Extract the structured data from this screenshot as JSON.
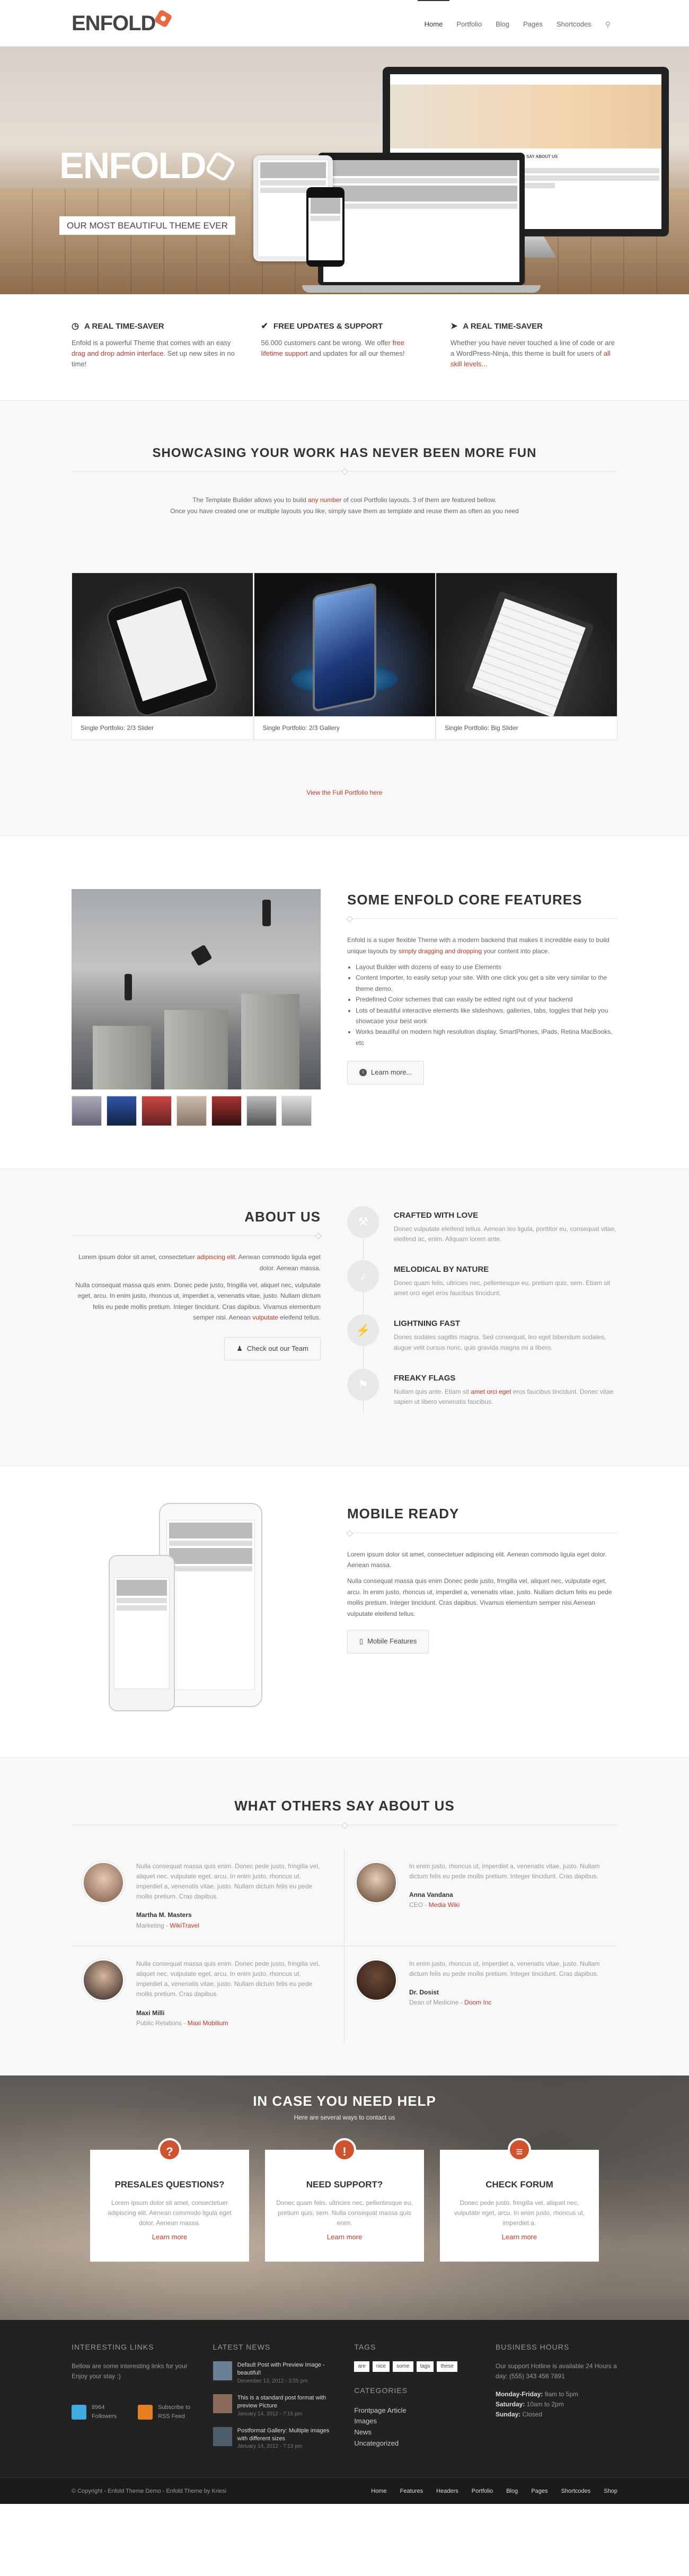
{
  "header": {
    "logo_text": "ENFOLD",
    "nav": [
      "Home",
      "Portfolio",
      "Blog",
      "Pages",
      "Shortcodes"
    ],
    "search_icon": "search-icon"
  },
  "hero": {
    "title": "ENFOLD",
    "tagline": "OUR MOST BEAUTIFUL THEME EVER",
    "screen_heading": "WHAT OTHERS SAY ABOUT US"
  },
  "features3": [
    {
      "icon": "clock-icon",
      "title": "A REAL TIME-SAVER",
      "pre": "Enfold is a powerful Theme that comes with an easy ",
      "link": "drag and drop admin interface.",
      "post": " Set up new sites in no time!"
    },
    {
      "icon": "check-icon",
      "title": "FREE UPDATES & SUPPORT",
      "pre": "56.000 customers cant be wrong. We offer ",
      "link": "free lifetime support",
      "post": " and updates for all our themes!"
    },
    {
      "icon": "rocket-icon",
      "title": "A REAL TIME-SAVER",
      "pre": "Whether you have never touched a line of code or are a WordPress-Ninja, this theme is built for users of ",
      "link": "all skill levels...",
      "post": ""
    }
  ],
  "showcase": {
    "title": "SHOWCASING YOUR WORK HAS NEVER BEEN MORE FUN",
    "intro_pre": "The Template Builder allows you to build ",
    "intro_link": "any number",
    "intro_post": " of cool Portfolio layouts. 3 of them are featured bellow.",
    "intro_line2": "Once you have created one or multiple layouts you like, simply save them as template and reuse them as often as you need",
    "items": [
      "Single Portfolio: 2/3 Slider",
      "Single Portfolio: 2/3 Gallery",
      "Single Portfolio: Big Slider"
    ],
    "view_all": "View the Full Portfolio here"
  },
  "core": {
    "title": "SOME ENFOLD CORE FEATURES",
    "p_pre": "Enfold is a super flexible Theme with a modern backend that makes it incredible easy to build unique layouts by ",
    "p_link": "simply dragging and dropping",
    "p_post": " your content into place.",
    "bullets": [
      "Layout Builder with dozens of easy to use Elements",
      "Content Importer, to easily setup your site. With one click you get a site very similar to the theme demo.",
      "Predefined Color schemes that can easily be edited right out of your backend",
      "Lots of beautiful interactive elements like slideshows, galleries, tabs, toggles that help you showcase your best work",
      "Works beautiful on modern high resolution display, SmartPhones, iPads, Retina MacBooks, etc"
    ],
    "button": "Learn more..."
  },
  "about": {
    "title": "ABOUT US",
    "p1_pre": "Lorem ipsum dolor sit amet, consectetuer ",
    "p1_link": "adipiscing elit",
    "p1_post": ". Aenean commodo ligula eget dolor. Aenean massa.",
    "p2": "Nulla consequat massa quis enim. Donec pede justo, fringilla vel, aliquet nec, vulputate eget, arcu. In enim justo, rhoncus ut, imperdiet a, venenatis vitae, justo. Nullam dictum felis eu pede mollis pretium. Integer tincidunt. Cras dapibus. Vivamus elementum semper nisi. Aenean ",
    "p2_link": "vulputate",
    "p2_post": " eleifend tellus.",
    "button": "Check out our Team",
    "items": [
      {
        "icon": "tools-icon",
        "title": "CRAFTED WITH LOVE",
        "text": "Donec vulputate eleifend tellus. Aenean leo ligula, porttitor eu, consequat vitae, eleifend ac, enim. Aliquam lorem ante."
      },
      {
        "icon": "music-note-icon",
        "title": "MELODICAL BY NATURE",
        "text": "Donec quam felis, ultricies nec, pellentesque eu, pretium quis, sem. Etiam sit amet orci eget eros faucibus tincidunt."
      },
      {
        "icon": "lightning-icon",
        "title": "LIGHTNING FAST",
        "text": "Donec sodales sagittis magna. Sed consequat, leo eget bibendum sodales, augue velit cursus nunc, quis gravida magna mi a libero."
      },
      {
        "icon": "flag-icon",
        "title": "FREAKY FLAGS",
        "text_pre": "Nullam quis ante. Etiam sit ",
        "text_link": "amet orci eget",
        "text_post": " eros faucibus tincidunt. Donec vitae sapien ut libero venenatis faucibus."
      }
    ]
  },
  "mobile": {
    "title": "MOBILE READY",
    "p1": "Lorem ipsum dolor sit amet, consectetuer adipiscing elit. Aenean commodo ligula eget dolor. Aenean massa.",
    "p2": "Nulla consequat massa quis enim Donec pede justo, fringilla vel, aliquet nec, vulputate eget, arcu. In enim justo, rhoncus ut, imperdiet a, venenatis vitae, justo. Nullam dictum felis eu pede mollis pretium. Integer tincidunt. Cras dapibus. Vivamus elementum semper nisi.Aenean vulputate eleifend tellus.",
    "button": "Mobile Features"
  },
  "testimonials": {
    "title": "WHAT OTHERS SAY ABOUT US",
    "items": [
      {
        "text": "Nulla consequat massa quis enim. Donec pede justo, fringilla vel, aliquet nec, vulputate eget, arcu. In enim justo, rhoncus ut, imperdiet a, venenatis vitae, justo. Nullam dictum felis eu pede mollis pretium. Cras dapibus.",
        "name": "Martha M. Masters",
        "role": "Marketing - ",
        "company": "WikiTravel"
      },
      {
        "text": "In enim justo, rhoncus ut, imperdiet a, venenatis vitae, justo. Nullam dictum felis eu pede mollis pretium. Integer tincidunt. Cras dapibus.",
        "name": "Anna Vandana",
        "role": "CEO - ",
        "company": "Media Wiki"
      },
      {
        "text": "Nulla consequat massa quis enim. Donec pede justo, fringilla vel, aliquet nec, vulputate eget, arcu. In enim justo, rhoncus ut, imperdiet a, venenatis vitae, justo. Nullam dictum felis eu pede mollis pretium. Cras dapibus.",
        "name": "Maxi Milli",
        "role": "Public Relations - ",
        "company": "Maxi Mobilium"
      },
      {
        "text": "In enim justo, rhoncus ut, imperdiet a, venenatis vitae, justo. Nullam dictum felis eu pede mollis pretium. Integer tincidunt. Cras dapibus.",
        "name": "Dr. Dosist",
        "role": "Dean of Medicine - ",
        "company": "Doom Inc"
      }
    ]
  },
  "help": {
    "title": "IN CASE YOU NEED HELP",
    "sub": "Here are several ways to contact us",
    "cards": [
      {
        "badge": "?",
        "title": "PRESALES QUESTIONS?",
        "text": "Lorem ipsum dolor sit amet, consectetuer adipiscing elit. Aenean commodo ligula eget dolor. Aenean massa.",
        "link": "Learn more"
      },
      {
        "badge": "!",
        "title": "NEED SUPPORT?",
        "text": "Donec quam felis, ultricies nec, pellentesque eu, pretium quis, sem. Nulla consequat massa quis enim.",
        "link": "Learn more"
      },
      {
        "badge": "≡",
        "title": "CHECK FORUM",
        "text": "Donec pede justo, fringilla vel, aliquet nec, vulputate eget, arcu. In enim justo, rhoncus ut, imperdiet a.",
        "link": "Learn more"
      }
    ]
  },
  "footer": {
    "links_title": "INTERESTING LINKS",
    "links_text": "Bellow are some interesting links for your Enjoy your stay :)",
    "twitter_count": "8964",
    "twitter_label": "Followers",
    "rss_label": "Subscribe to RSS Feed",
    "news_title": "LATEST NEWS",
    "news": [
      {
        "title": "Default Post with Preview Image - beautiful!",
        "date": "December 13, 2012 - 3:55 pm"
      },
      {
        "title": "This is a standard post format with preview Picture",
        "date": "January 14, 2012 - 7:15 pm"
      },
      {
        "title": "Postformat Gallery: Multiple images with different sizes",
        "date": "January 14, 2012 - 7:13 pm"
      }
    ],
    "tags_title": "TAGS",
    "tags": [
      "are",
      "nice",
      "some",
      "tags",
      "these"
    ],
    "cats_title": "CATEGORIES",
    "cats": [
      "Frontpage Article",
      "Images",
      "News",
      "Uncategorized"
    ],
    "hours_title": "BUSINESS HOURS",
    "hours_text": "Our support Hotline is available 24 Hours a day: (555) 343 456 7891",
    "hours": [
      {
        "day": "Monday-Friday:",
        "time": " 9am to 5pm"
      },
      {
        "day": "Saturday:",
        "time": " 10am to 2pm"
      },
      {
        "day": "Sunday:",
        "time": " Closed"
      }
    ]
  },
  "socket": {
    "copyright": "© Copyright - Enfold Theme Demo - Enfold Theme by Kriesi",
    "links": [
      "Home",
      "Features",
      "Headers",
      "Portfolio",
      "Blog",
      "Pages",
      "Shortcodes",
      "Shop"
    ]
  },
  "colors": {
    "accent": "#c0392b",
    "badge": "#d0532f",
    "footer_bg": "#222222",
    "logo_hex": "#e56a42"
  }
}
